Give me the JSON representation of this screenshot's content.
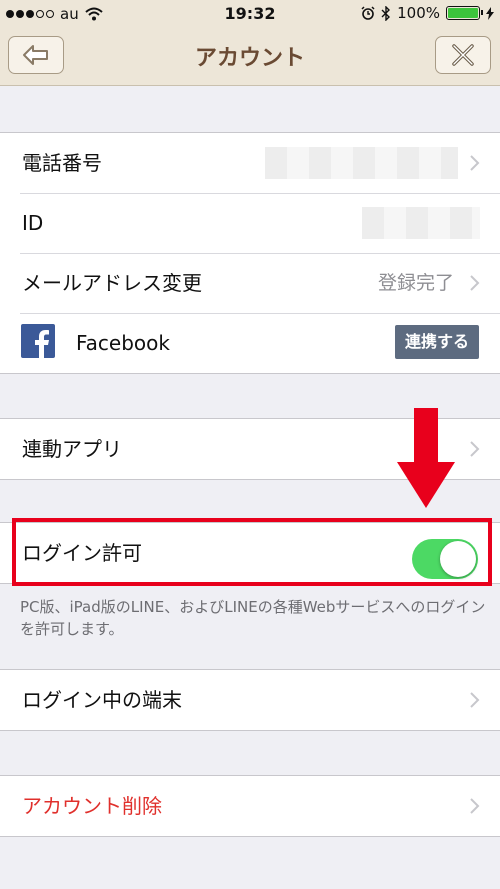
{
  "status_bar": {
    "carrier": "au",
    "time": "19:32",
    "battery": "100%",
    "battery_level": 1.0
  },
  "nav": {
    "title": "アカウント"
  },
  "account_group": {
    "phone_label": "電話番号",
    "id_label": "ID",
    "email_label": "メールアドレス変更",
    "email_status": "登録完了",
    "facebook_label": "Facebook",
    "facebook_button": "連携する"
  },
  "linked_apps": {
    "label": "連動アプリ"
  },
  "login_permission": {
    "label": "ログイン許可",
    "enabled": true,
    "note": "PC版、iPad版のLINE、およびLINEの各種Webサービスへのログインを許可します。"
  },
  "logged_in_devices": {
    "label": "ログイン中の端末"
  },
  "delete_account": {
    "label": "アカウント削除"
  },
  "colors": {
    "toggle_on": "#4cd964",
    "highlight": "#e8001c",
    "danger_text": "#e0302c",
    "facebook_blue": "#3b5998"
  }
}
